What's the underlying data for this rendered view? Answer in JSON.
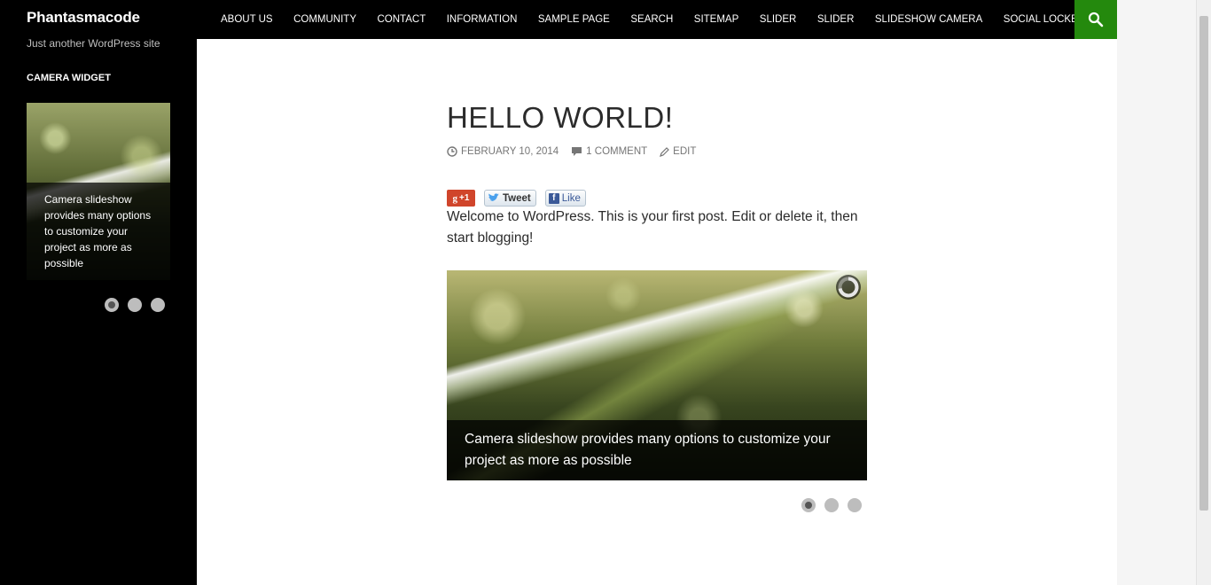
{
  "site": {
    "title": "Phantasmacode",
    "description": "Just another WordPress site"
  },
  "sidebar": {
    "widget_title": "CAMERA WIDGET",
    "slide_caption": "Camera slideshow provides many options to customize your project as more as possible",
    "pager_count": 3,
    "active_index": 0
  },
  "nav": {
    "items": [
      {
        "label": "ABOUT US"
      },
      {
        "label": "COMMUNITY"
      },
      {
        "label": "CONTACT"
      },
      {
        "label": "INFORMATION"
      },
      {
        "label": "SAMPLE PAGE"
      },
      {
        "label": "SEARCH"
      },
      {
        "label": "SITEMAP"
      },
      {
        "label": "SLIDER"
      },
      {
        "label": "SLIDER"
      },
      {
        "label": "SLIDESHOW CAMERA"
      },
      {
        "label": "SOCIAL LOCKER DEMO"
      }
    ],
    "search_icon": "search-icon",
    "search_bg": "#24890d"
  },
  "post": {
    "title": "HELLO WORLD!",
    "date": "FEBRUARY 10, 2014",
    "comments": "1 COMMENT",
    "edit": "EDIT",
    "share": {
      "gplus": "+1",
      "tweet": "Tweet",
      "like": "Like"
    },
    "body": "Welcome to WordPress. This is your first post. Edit or delete it, then start blogging!",
    "slide_caption": "Camera slideshow provides many options to customize your project as more as possible",
    "pager_count": 3,
    "active_index": 0
  },
  "colors": {
    "sidebar_bg": "#000000",
    "accent": "#24890d",
    "meta_text": "#767676"
  }
}
